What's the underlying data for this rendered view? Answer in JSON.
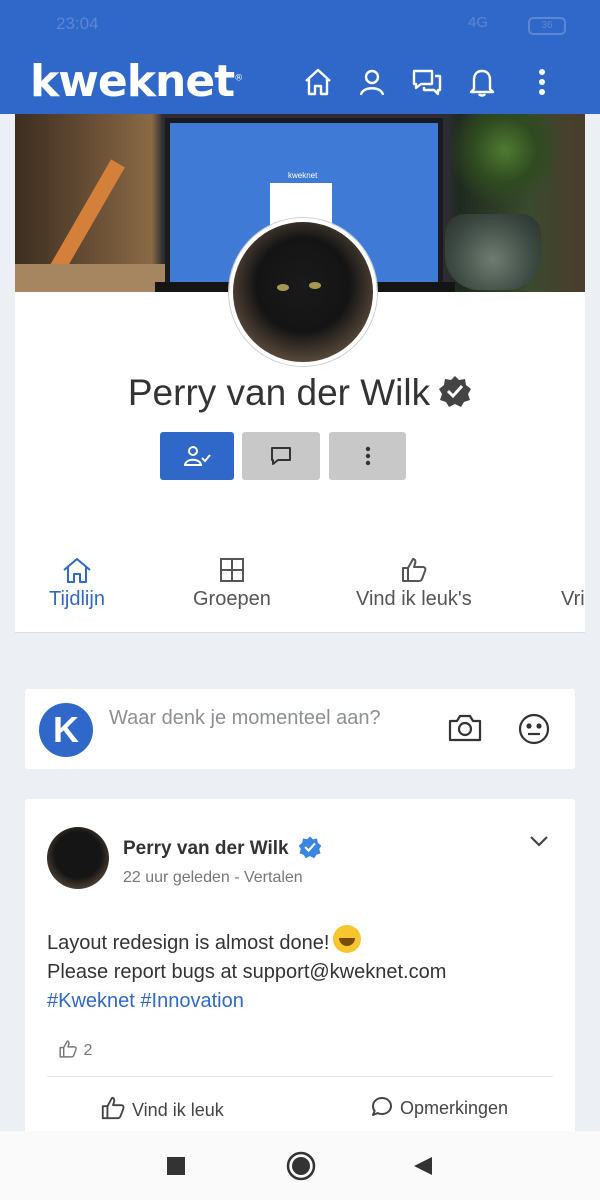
{
  "statusbar": {
    "time": "23:04",
    "network": "4G",
    "battery": "36"
  },
  "app": {
    "logo": "kweknet",
    "logo_mark": "®",
    "mini_brand": "kweknet"
  },
  "profile": {
    "name": "Perry van der Wilk"
  },
  "tabs": [
    {
      "label": "Tijdlijn",
      "icon": "home-icon",
      "active": true
    },
    {
      "label": "Groepen",
      "icon": "grid-icon",
      "active": false
    },
    {
      "label": "Vind ik leuk's",
      "icon": "thumbs-up-icon",
      "active": false
    },
    {
      "label": "Vri",
      "icon": "friends-icon",
      "active": false
    }
  ],
  "composer": {
    "placeholder": "Waar denk je momenteel aan?",
    "avatar_letter": "K"
  },
  "post": {
    "author": "Perry van der Wilk",
    "time": "22 uur geleden",
    "separator": " - ",
    "translate": "Vertalen",
    "line1": "Layout redesign is almost done!",
    "line2": "Please report bugs at support@kweknet.com",
    "hashtag1": "#Kweknet",
    "hashtag2": "#Innovation",
    "likes_count": "2",
    "like_label": "Vind ik leuk",
    "comment_label": "Opmerkingen"
  },
  "colors": {
    "brand": "#2f68c8",
    "grey_button": "#c8c8c8"
  }
}
